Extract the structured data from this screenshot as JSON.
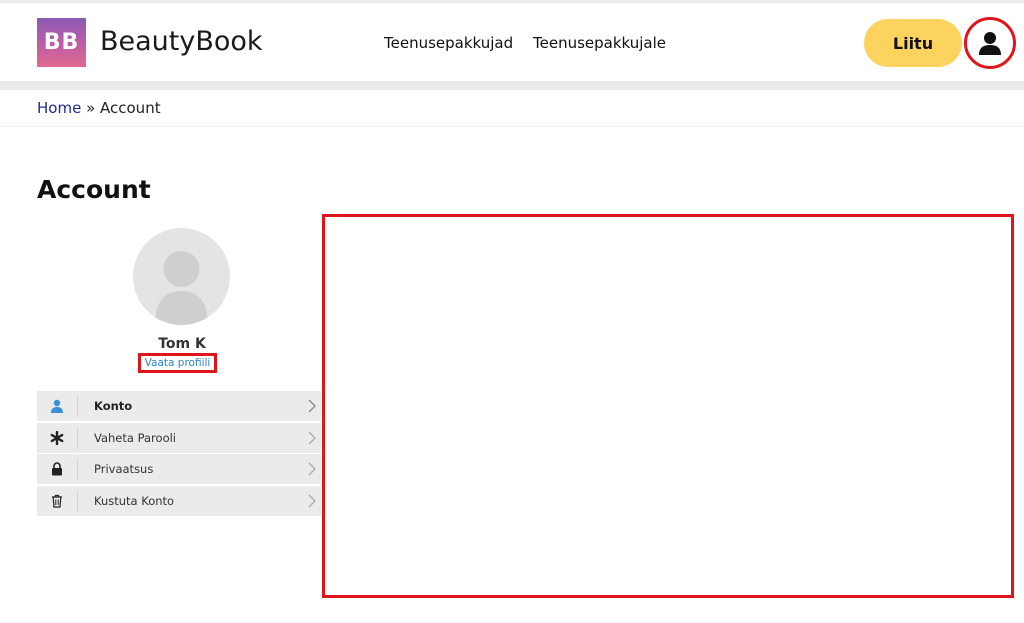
{
  "header": {
    "logo_text": "BB",
    "brand": "BeautyBook",
    "nav": [
      "Teenusepakkujad",
      "Teenusepakkujale"
    ],
    "join_label": "Liitu",
    "user_icon": "user-icon"
  },
  "breadcrumb": {
    "home": "Home",
    "separator": " » ",
    "current": "Account"
  },
  "page": {
    "title": "Account"
  },
  "profile": {
    "name": "Tom K",
    "view_profile": "Vaata profiili"
  },
  "menu": {
    "items": [
      {
        "label": "Konto",
        "icon": "user-icon",
        "active": true
      },
      {
        "label": "Vaheta Parooli",
        "icon": "asterisk-icon",
        "active": false
      },
      {
        "label": "Privaatsus",
        "icon": "lock-icon",
        "active": false
      },
      {
        "label": "Kustuta Konto",
        "icon": "trash-icon",
        "active": false
      }
    ]
  },
  "colors": {
    "accent_yellow": "#fdd35f",
    "highlight_red": "#e0141b",
    "link_blue": "#2c83c7",
    "breadcrumb_blue": "#1f2c8f",
    "menu_bg": "#ebebeb"
  }
}
